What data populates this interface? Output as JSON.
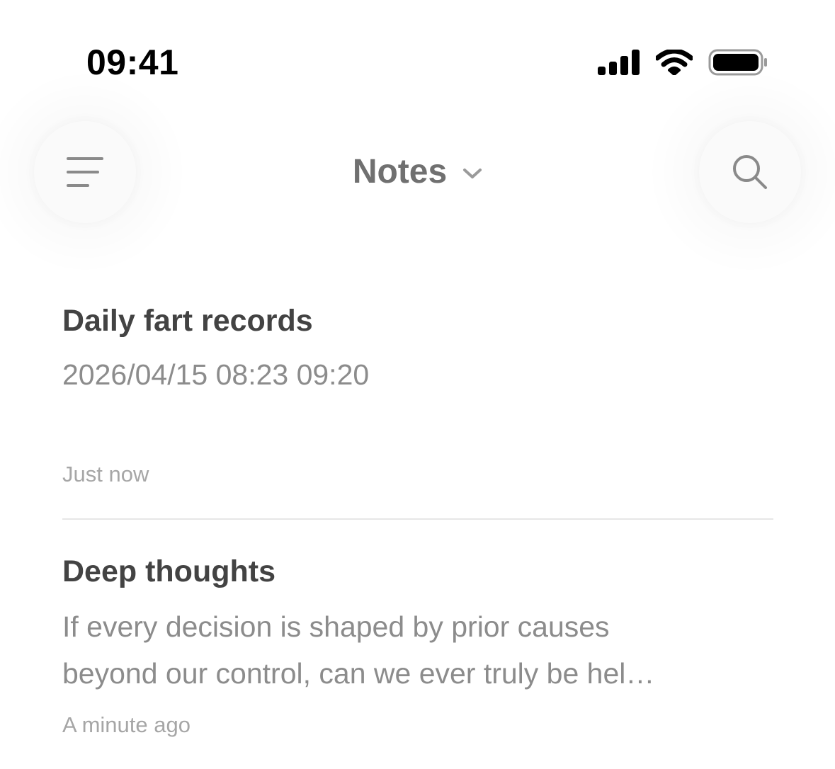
{
  "status_bar": {
    "time": "09:41",
    "icons": [
      "cellular-signal-icon",
      "wifi-icon",
      "battery-icon"
    ]
  },
  "header": {
    "title": "Notes",
    "menu_icon": "menu-lines-icon",
    "search_icon": "search-icon",
    "dropdown_icon": "chevron-down-icon"
  },
  "notes": [
    {
      "title": "Daily fart records",
      "preview": "2026/04/15 08:23 09:20",
      "time": "Just now"
    },
    {
      "title": "Deep thoughts",
      "preview_lines": [
        "If every decision is shaped by prior causes",
        "beyond our control, can we ever truly be hel…"
      ],
      "time": "A minute ago"
    }
  ],
  "colors": {
    "background": "#ffffff",
    "title_text": "#707070",
    "note_title": "#434343",
    "note_preview": "#8c8c8c",
    "note_time": "#a6a6a6",
    "divider": "#e6e6e6"
  }
}
